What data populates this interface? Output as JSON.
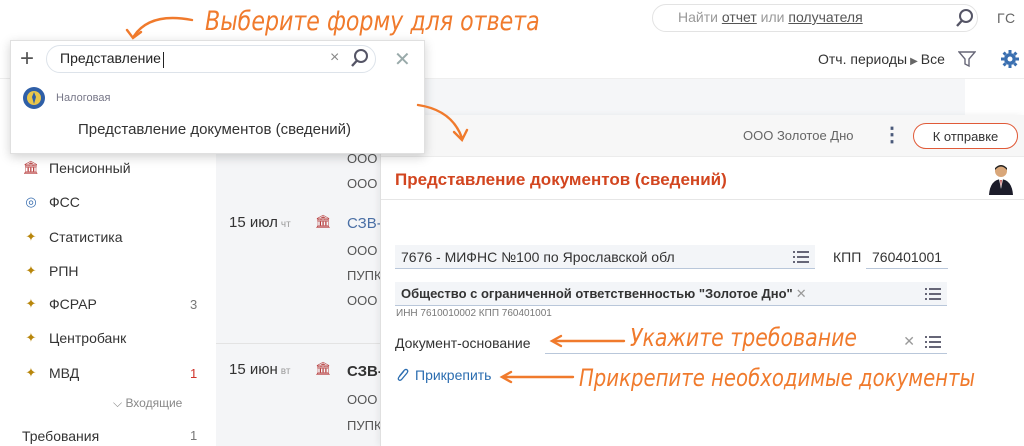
{
  "header": {
    "search_prefix": "Найти ",
    "search_link1": "отчет",
    "search_mid": " или ",
    "search_link2": "получателя",
    "user_initials": "ГС"
  },
  "filters": {
    "periods_label": "Отч. периоды",
    "periods_value": "Все"
  },
  "dropdown": {
    "input_value": "Представление",
    "org_name": "Налоговая",
    "option": "Представление документов (сведений)"
  },
  "sidebar": {
    "items": [
      {
        "label": "Пенсионный",
        "count": ""
      },
      {
        "label": "ФСС",
        "count": ""
      },
      {
        "label": "Статистика",
        "count": ""
      },
      {
        "label": "РПН",
        "count": ""
      },
      {
        "label": "ФСРАР",
        "count": "3"
      },
      {
        "label": "Центробанк",
        "count": ""
      },
      {
        "label": "МВД",
        "count": "1"
      }
    ],
    "incoming_label": "Входящие",
    "requirements_label": "Требования",
    "requirements_count": "1"
  },
  "middle": {
    "ooo1": "ООО",
    "ooo2": "ООО",
    "entry1": {
      "day": "15",
      "month": "июл",
      "dow": "чт",
      "code": "СЗВ-",
      "line2": "ООО",
      "line3": "ПУПК",
      "line4": "ООО"
    },
    "entry2": {
      "day": "15",
      "month": "июн",
      "dow": "вт",
      "code": "СЗВ-",
      "line2": "ООО",
      "line3": "ПУПК"
    }
  },
  "card": {
    "company": "ООО Золотое Дно",
    "send_button": "К отправке",
    "title": "Представление документов (сведений)",
    "ifns_value": "7676 - МИФНС №100 по Ярославской обл",
    "kpp_label": "КПП",
    "kpp_value": "760401001",
    "org_value": "Общество с ограниченной ответственностью \"Золотое Дно\"",
    "inn_kpp": "ИНН 7610010002 КПП 760401001",
    "doc_basis_label": "Документ-основание",
    "attach_label": "Прикрепить"
  },
  "annotations": {
    "choose_form": "Выберите форму для ответа",
    "specify_requirement": "Укажите требование",
    "attach_docs": "Прикрепите необходимые документы"
  },
  "colors": {
    "accent_orange": "#f07a2c",
    "title_red": "#d2451f",
    "link_blue": "#2b6db0"
  }
}
